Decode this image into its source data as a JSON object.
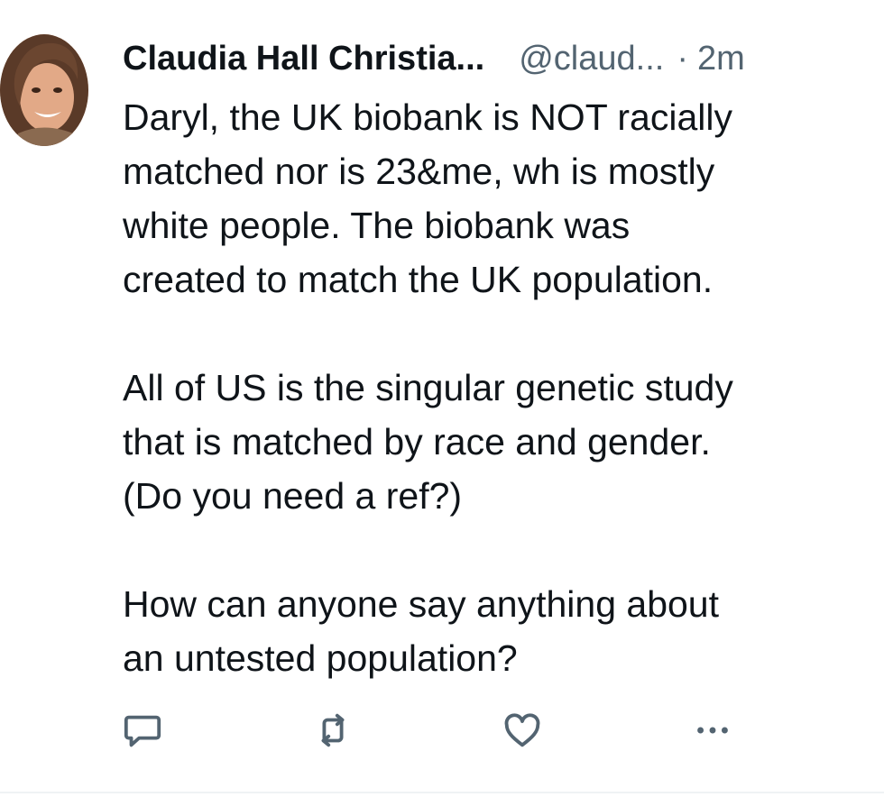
{
  "author": {
    "display_name": "Claudia Hall Christia...",
    "handle": "@claud...",
    "separator": "·",
    "timestamp": "2m"
  },
  "body": {
    "paragraphs": [
      [
        "Daryl, the UK biobank is NOT racially",
        "matched nor is 23&me, wh is mostly",
        "white people. The biobank was",
        "created to match the UK population."
      ],
      [
        "All of US is the singular genetic study",
        "that is matched by race and gender.",
        "(Do you need a ref?)"
      ],
      [
        "How can anyone say anything about",
        "an untested population?"
      ]
    ]
  },
  "actions": {
    "reply_icon": "reply-icon",
    "repost_icon": "repost-icon",
    "like_icon": "heart-icon",
    "more_icon": "more-icon"
  },
  "colors": {
    "text": "#0f1419",
    "secondary": "#536471",
    "icon": "#536471"
  }
}
